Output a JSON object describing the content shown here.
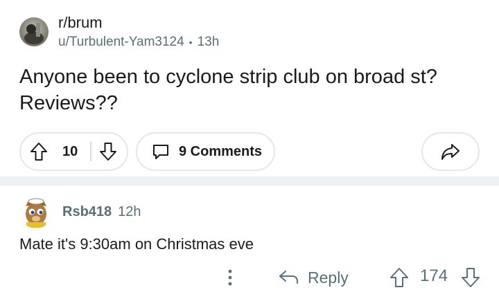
{
  "post": {
    "subreddit": "r/brum",
    "author": "u/Turbulent-Yam3124",
    "separator": "•",
    "age": "13h",
    "title": "Anyone been to cyclone strip club on broad st? Reviews??",
    "vote_count": "10",
    "comments_label": "9 Comments"
  },
  "comment": {
    "author": "Rsb418",
    "age": "12h",
    "body": "Mate it's 9:30am on Christmas eve",
    "reply_label": "Reply",
    "score": "174"
  },
  "icons": {
    "upvote": "arrow-up-icon",
    "downvote": "arrow-down-icon",
    "comments": "speech-bubble-icon",
    "share": "share-arrow-icon",
    "more": "vertical-dots-icon",
    "reply": "reply-arrow-icon"
  },
  "colors": {
    "text": "#1a1a1b",
    "muted": "#576f76",
    "border": "#e4e6e8",
    "divider": "#eef1f3"
  }
}
